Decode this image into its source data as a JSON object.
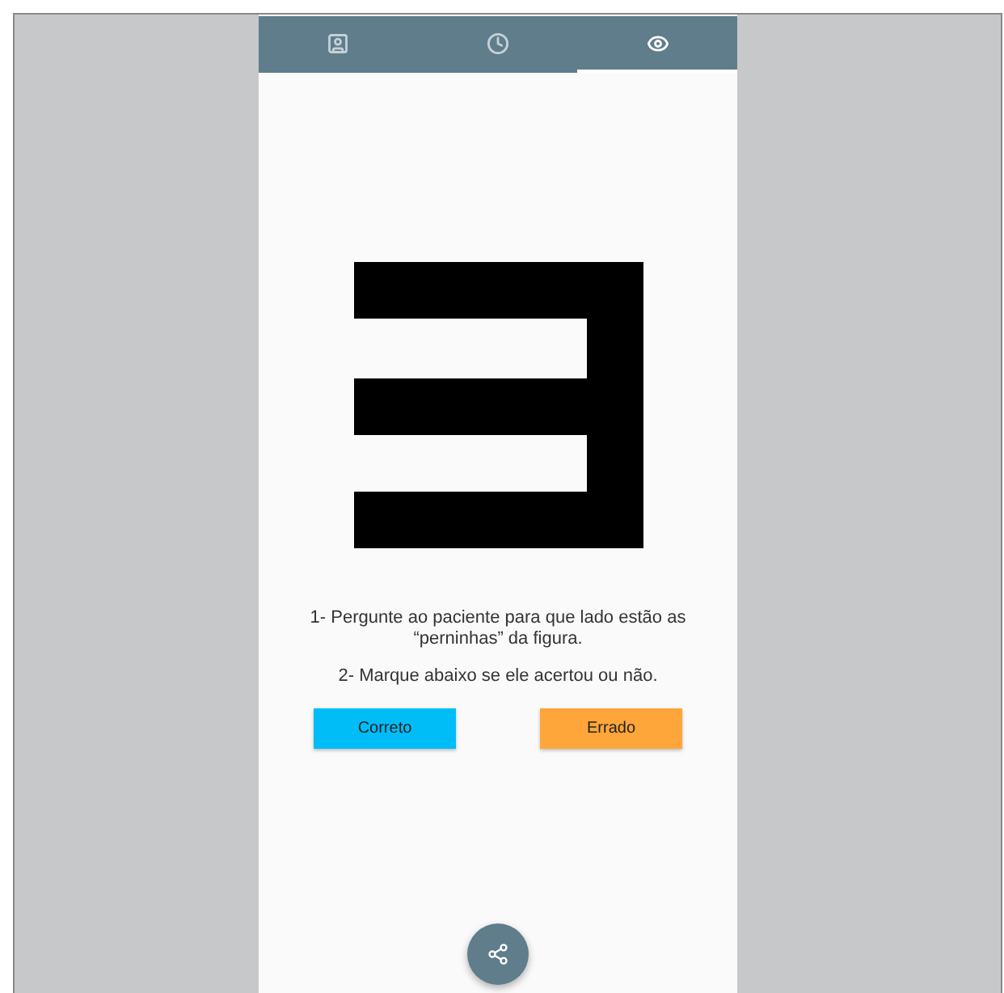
{
  "tabs": [
    {
      "kind": "contact",
      "selected": false
    },
    {
      "kind": "clock",
      "selected": false
    },
    {
      "kind": "eye",
      "selected": true
    }
  ],
  "figure": {
    "kind": "tumbling-e"
  },
  "instructions": [
    "1- Pergunte ao paciente para que lado estão as “perninhas” da figura.",
    "2- Marque abaixo se ele acertou ou não."
  ],
  "buttons": [
    {
      "kind": "correct",
      "label": "Correto"
    },
    {
      "kind": "wrong",
      "label": "Errado"
    }
  ],
  "fab": {
    "kind": "share"
  }
}
